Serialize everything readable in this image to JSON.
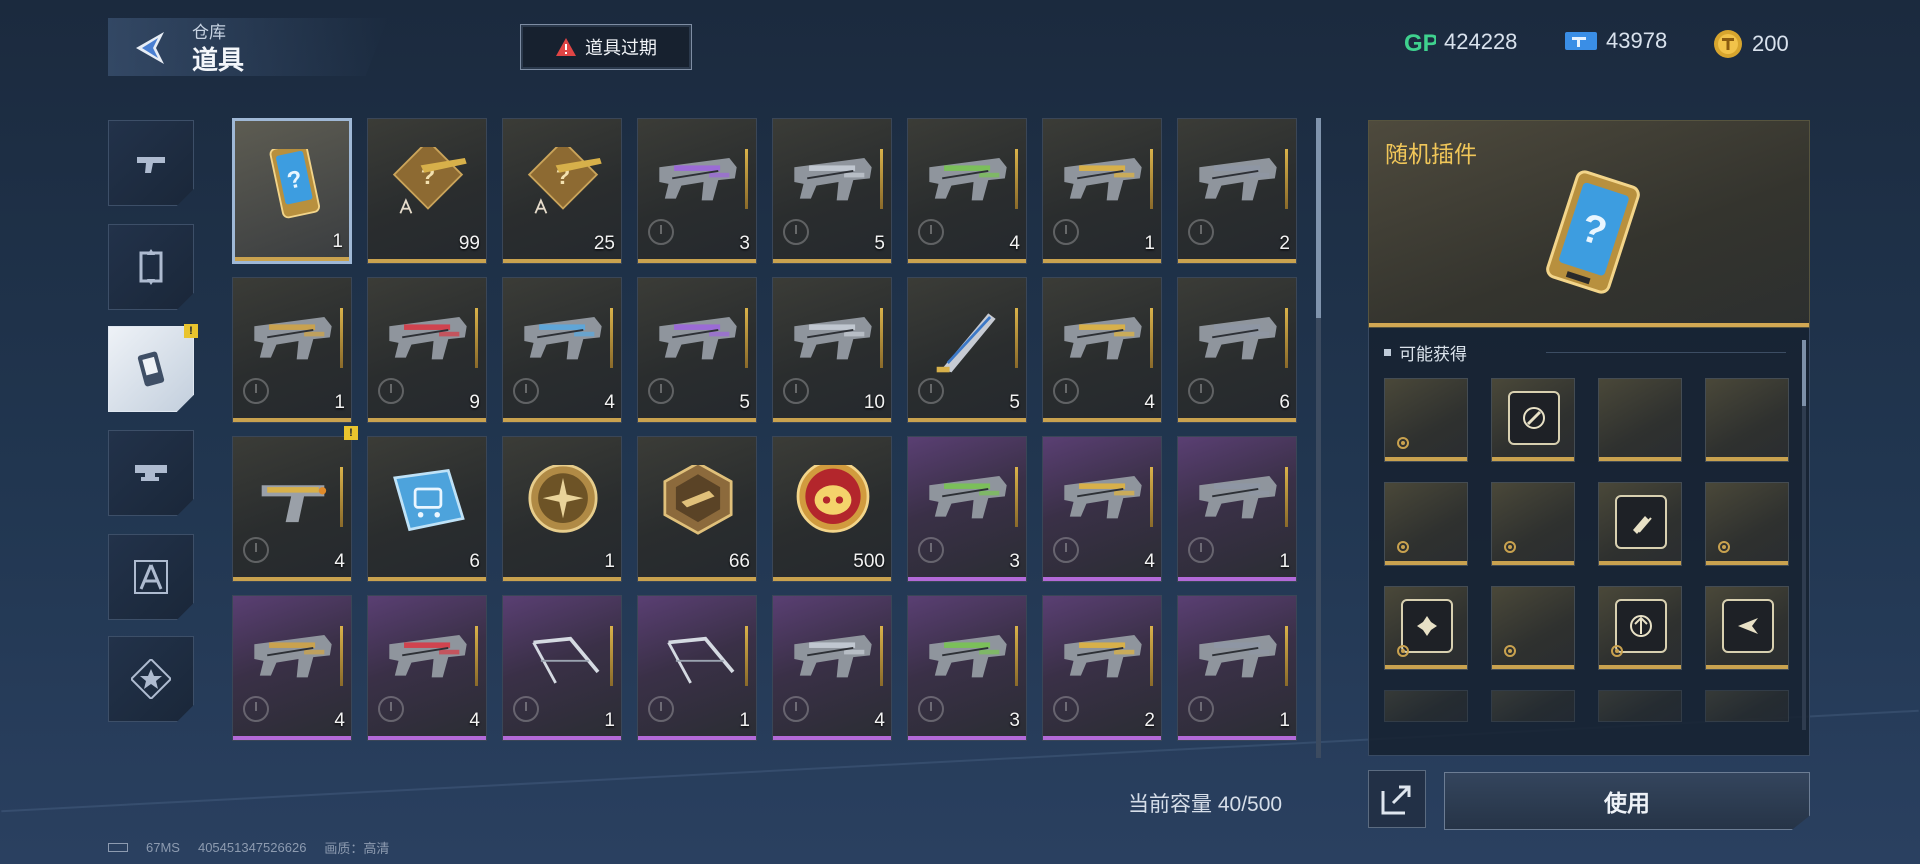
{
  "header": {
    "title_small": "仓库",
    "title_big": "道具",
    "expire_label": "道具过期",
    "currencies": [
      {
        "icon": "gp-icon",
        "value": "424228"
      },
      {
        "icon": "ticket-icon",
        "value": "43978"
      },
      {
        "icon": "coin-icon",
        "value": "200"
      }
    ]
  },
  "tabs": [
    {
      "icon": "pistol-icon",
      "active": false
    },
    {
      "icon": "card-frame-icon",
      "active": false
    },
    {
      "icon": "item-card-icon",
      "active": true,
      "badge": "!"
    },
    {
      "icon": "weapon-mod-icon",
      "active": false
    },
    {
      "icon": "compass-tool-icon",
      "active": false
    },
    {
      "icon": "star-badge-icon",
      "active": false
    }
  ],
  "items": [
    {
      "count": "1",
      "rarity": "gold",
      "kind": "mystery-card",
      "selected": true
    },
    {
      "count": "99",
      "rarity": "gold",
      "kind": "blueprint-box"
    },
    {
      "count": "25",
      "rarity": "gold",
      "kind": "blueprint-box"
    },
    {
      "count": "3",
      "rarity": "gold",
      "kind": "rifle"
    },
    {
      "count": "5",
      "rarity": "gold",
      "kind": "rifle"
    },
    {
      "count": "4",
      "rarity": "gold",
      "kind": "rifle"
    },
    {
      "count": "1",
      "rarity": "gold",
      "kind": "rifle"
    },
    {
      "count": "2",
      "rarity": "gold",
      "kind": "rifle"
    },
    {
      "count": "1",
      "rarity": "gold",
      "kind": "rifle"
    },
    {
      "count": "9",
      "rarity": "gold",
      "kind": "rifle"
    },
    {
      "count": "4",
      "rarity": "gold",
      "kind": "rifle"
    },
    {
      "count": "5",
      "rarity": "gold",
      "kind": "rifle"
    },
    {
      "count": "10",
      "rarity": "gold",
      "kind": "rifle"
    },
    {
      "count": "5",
      "rarity": "gold",
      "kind": "blade"
    },
    {
      "count": "4",
      "rarity": "gold",
      "kind": "rifle"
    },
    {
      "count": "6",
      "rarity": "gold",
      "kind": "rifle"
    },
    {
      "count": "4",
      "rarity": "gold",
      "kind": "pistol",
      "badge": "!"
    },
    {
      "count": "6",
      "rarity": "gold",
      "kind": "chip"
    },
    {
      "count": "1",
      "rarity": "gold",
      "kind": "medal"
    },
    {
      "count": "66",
      "rarity": "gold",
      "kind": "hex-badge"
    },
    {
      "count": "500",
      "rarity": "gold",
      "kind": "pig-coin"
    },
    {
      "count": "3",
      "rarity": "purple",
      "kind": "rifle"
    },
    {
      "count": "4",
      "rarity": "purple",
      "kind": "rifle"
    },
    {
      "count": "1",
      "rarity": "purple",
      "kind": "rifle"
    },
    {
      "count": "4",
      "rarity": "purple",
      "kind": "rifle"
    },
    {
      "count": "4",
      "rarity": "purple",
      "kind": "rifle"
    },
    {
      "count": "1",
      "rarity": "purple",
      "kind": "bow"
    },
    {
      "count": "1",
      "rarity": "purple",
      "kind": "bow"
    },
    {
      "count": "4",
      "rarity": "purple",
      "kind": "rifle"
    },
    {
      "count": "3",
      "rarity": "purple",
      "kind": "rifle"
    },
    {
      "count": "2",
      "rarity": "purple",
      "kind": "rifle"
    },
    {
      "count": "1",
      "rarity": "purple",
      "kind": "rifle"
    }
  ],
  "capacity_label": "当前容量 40/500",
  "detail": {
    "title": "随机插件",
    "possible_label": "可能获得",
    "rewards": [
      {
        "kind": "gear"
      },
      {
        "kind": "folder-shield"
      },
      {
        "kind": "blank"
      },
      {
        "kind": "blank"
      },
      {
        "kind": "gear"
      },
      {
        "kind": "gear"
      },
      {
        "kind": "folder-bullets"
      },
      {
        "kind": "gear"
      },
      {
        "kind": "folder-cross"
      },
      {
        "kind": "gear"
      },
      {
        "kind": "folder-arrow"
      },
      {
        "kind": "folder-wing"
      }
    ]
  },
  "use_label": "使用",
  "footer": {
    "ping": "67MS",
    "uid": "405451347526626",
    "quality": "画质：高清"
  },
  "colors": {
    "gold": "#c9a24f",
    "purple": "#b36ad8",
    "accent_title": "#f0c659"
  }
}
